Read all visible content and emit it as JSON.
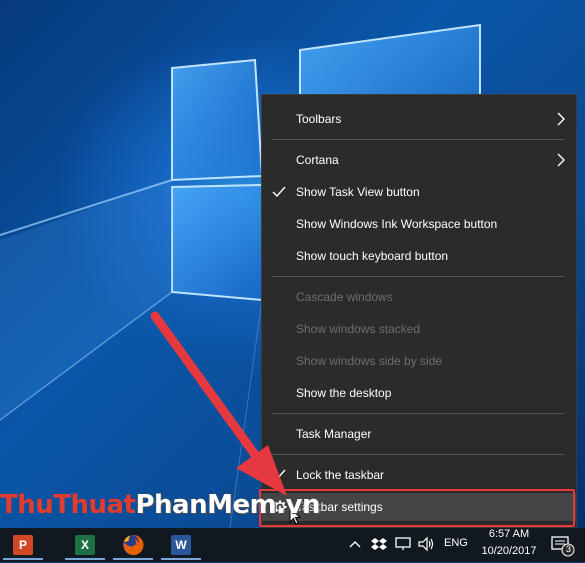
{
  "context_menu": {
    "items": [
      {
        "label": "Toolbars",
        "enabled": true,
        "checked": false,
        "submenu": true
      },
      {
        "label": "Cortana",
        "enabled": true,
        "checked": false,
        "submenu": true
      },
      {
        "label": "Show Task View button",
        "enabled": true,
        "checked": true,
        "submenu": false
      },
      {
        "label": "Show Windows Ink Workspace button",
        "enabled": true,
        "checked": false,
        "submenu": false
      },
      {
        "label": "Show touch keyboard button",
        "enabled": true,
        "checked": false,
        "submenu": false
      },
      {
        "label": "Cascade windows",
        "enabled": false,
        "checked": false,
        "submenu": false
      },
      {
        "label": "Show windows stacked",
        "enabled": false,
        "checked": false,
        "submenu": false
      },
      {
        "label": "Show windows side by side",
        "enabled": false,
        "checked": false,
        "submenu": false
      },
      {
        "label": "Show the desktop",
        "enabled": true,
        "checked": false,
        "submenu": false
      },
      {
        "label": "Task Manager",
        "enabled": true,
        "checked": false,
        "submenu": false
      },
      {
        "label": "Lock the taskbar",
        "enabled": true,
        "checked": true,
        "submenu": false
      },
      {
        "label": "Taskbar settings",
        "enabled": true,
        "checked": false,
        "submenu": false,
        "icon": "gear-icon",
        "highlighted": true
      }
    ]
  },
  "watermark": {
    "part1": "ThuThuat",
    "part2": "PhanMem.vn"
  },
  "taskbar": {
    "apps": [
      {
        "name": "PowerPoint",
        "icon": "powerpoint-icon",
        "letter": "P",
        "color": "#d24726"
      },
      {
        "name": "Excel",
        "icon": "excel-icon",
        "letter": "X",
        "color": "#1e7145"
      },
      {
        "name": "Firefox",
        "icon": "firefox-icon",
        "letter": "",
        "color": "#e66000"
      },
      {
        "name": "Word",
        "icon": "word-icon",
        "letter": "W",
        "color": "#2b579a"
      }
    ],
    "tray": {
      "language": "ENG",
      "time": "6:57 AM",
      "date": "10/20/2017",
      "notification_count": "3"
    }
  },
  "colors": {
    "menu_bg": "#2b2b2b",
    "highlight_border": "#e5383f",
    "arrow": "#e5383f",
    "taskbar_bg": "#101820"
  }
}
